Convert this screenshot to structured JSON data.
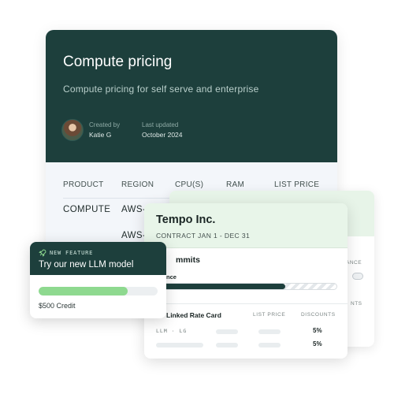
{
  "main_card": {
    "title": "Compute pricing",
    "subtitle": "Compute pricing for self serve and enterprise",
    "created_by_label": "Created by",
    "created_by": "Katie G",
    "last_updated_label": "Last updated",
    "last_updated": "October 2024",
    "table": {
      "headers": [
        "PRODUCT",
        "REGION",
        "CPU(S)",
        "RAM",
        "LIST PRICE"
      ],
      "rows": [
        [
          "COMPUTE",
          "AWS-"
        ],
        [
          "",
          "AWS-"
        ]
      ]
    }
  },
  "back_card": {
    "balance_label": "ANCE",
    "discounts_label": "NTS"
  },
  "tempo_card": {
    "name": "Tempo Inc.",
    "contract": "CONTRACT JAN 1 - DEC 31",
    "commits_label": "mmits",
    "balance_label": "nce",
    "progress": 0.72,
    "rate_card_title": "Linked Rate Card",
    "list_price_header": "LIST PRICE",
    "discounts_header": "DISCOUNTS",
    "rows": [
      {
        "item": "LLM · LG",
        "discount": "5%"
      },
      {
        "item": "",
        "discount": "5%"
      }
    ]
  },
  "feature_card": {
    "badge": "NEW FEATURE",
    "title": "Try our new LLM model",
    "credit": "$500 Credit",
    "credit_progress": 0.75,
    "icon": "rocket-icon"
  },
  "colors": {
    "dark_teal": "#1d3f3c",
    "light_green": "#e8f5e9",
    "credit_green": "#8ed98f"
  }
}
